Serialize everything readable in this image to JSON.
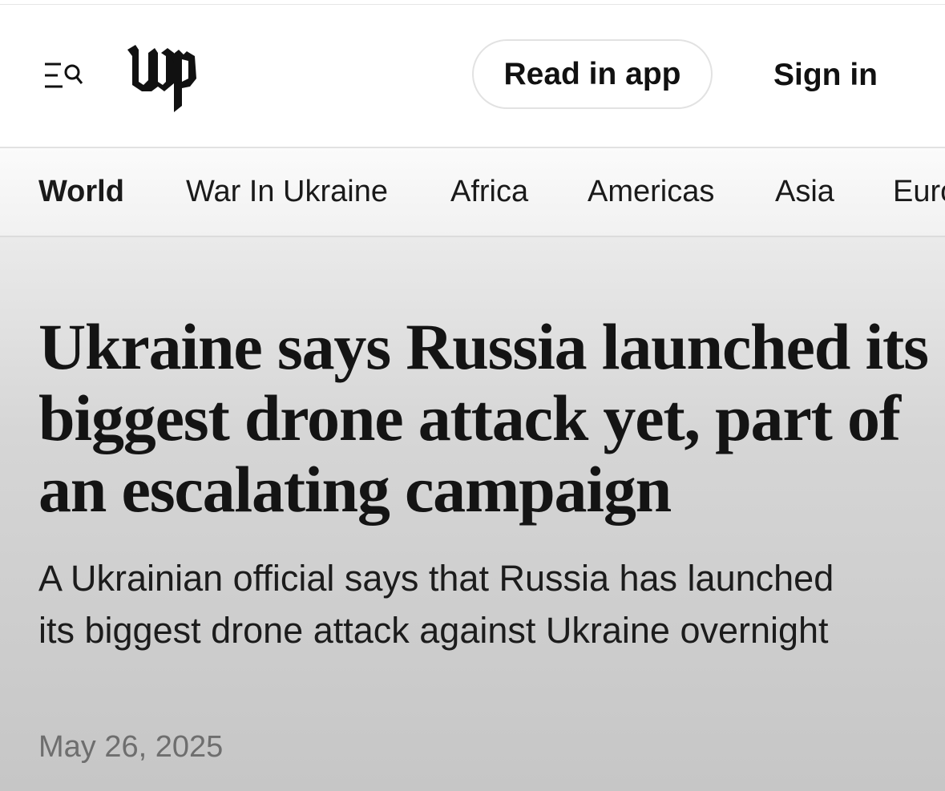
{
  "header": {
    "logo_text": "wp",
    "read_in_app_label": "Read in app",
    "sign_in_label": "Sign in"
  },
  "nav": {
    "items": [
      {
        "label": "World",
        "active": true
      },
      {
        "label": "War In Ukraine",
        "active": false
      },
      {
        "label": "Africa",
        "active": false
      },
      {
        "label": "Americas",
        "active": false
      },
      {
        "label": "Asia",
        "active": false
      },
      {
        "label": "Europe",
        "active": false
      }
    ]
  },
  "article": {
    "headline": "Ukraine says Russia launched its biggest drone attack yet, part of an escalating campaign",
    "dek": "A Ukrainian official says that Russia has launched its biggest drone attack against Ukraine overnight",
    "date": "May 26, 2025"
  },
  "icons": {
    "menu": "menu-search-icon"
  },
  "colors": {
    "text": "#111111",
    "date": "#6e6e6e",
    "button_border": "#e2e2e2"
  }
}
